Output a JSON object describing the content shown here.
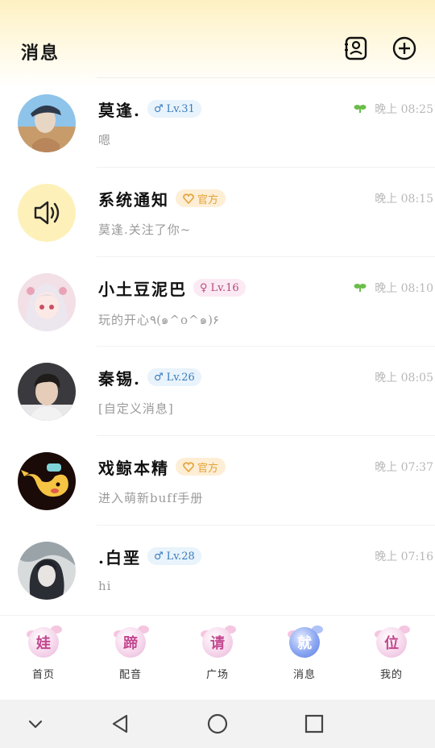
{
  "header": {
    "title": "消息"
  },
  "conversations": [
    {
      "name": "莫逢.",
      "badge_type": "male",
      "badge_text": "Lv.31",
      "time": "晚上 08:25",
      "preview": "嗯",
      "has_sprout": true,
      "avatar": "avatar-man-cap"
    },
    {
      "name": "系统通知",
      "badge_type": "official",
      "badge_text": "官方",
      "time": "晚上 08:15",
      "preview": "莫逢.关注了你~",
      "has_sprout": false,
      "avatar": "speaker-icon"
    },
    {
      "name": "小土豆泥巴",
      "badge_type": "female",
      "badge_text": "Lv.16",
      "time": "晚上 08:10",
      "preview": "玩的开心٩(๑^o^๑)۶",
      "has_sprout": true,
      "avatar": "avatar-anime-girl"
    },
    {
      "name": "秦锡.",
      "badge_type": "male",
      "badge_text": "Lv.26",
      "time": "晚上 08:05",
      "preview": "[自定义消息]",
      "has_sprout": false,
      "avatar": "avatar-young-man"
    },
    {
      "name": "戏鲸本精",
      "badge_type": "official",
      "badge_text": "官方",
      "time": "晚上 07:37",
      "preview": "进入萌新buff手册",
      "has_sprout": false,
      "avatar": "avatar-whale-mascot"
    },
    {
      "name": ".白垩",
      "badge_type": "male",
      "badge_text": "Lv.28",
      "time": "晚上 07:16",
      "preview": "hi",
      "has_sprout": false,
      "avatar": "avatar-dark-anime"
    }
  ],
  "tabs": [
    {
      "char": "娃",
      "label": "首页",
      "active": false
    },
    {
      "char": "蹄",
      "label": "配音",
      "active": false
    },
    {
      "char": "请",
      "label": "广场",
      "active": false
    },
    {
      "char": "就",
      "label": "消息",
      "active": true
    },
    {
      "char": "位",
      "label": "我的",
      "active": false
    }
  ],
  "colors": {
    "accent_blue": "#3a7bbf",
    "female_pink": "#b8477e",
    "official_orange": "#e3a23b",
    "sprout_green": "#6bbd4a"
  }
}
